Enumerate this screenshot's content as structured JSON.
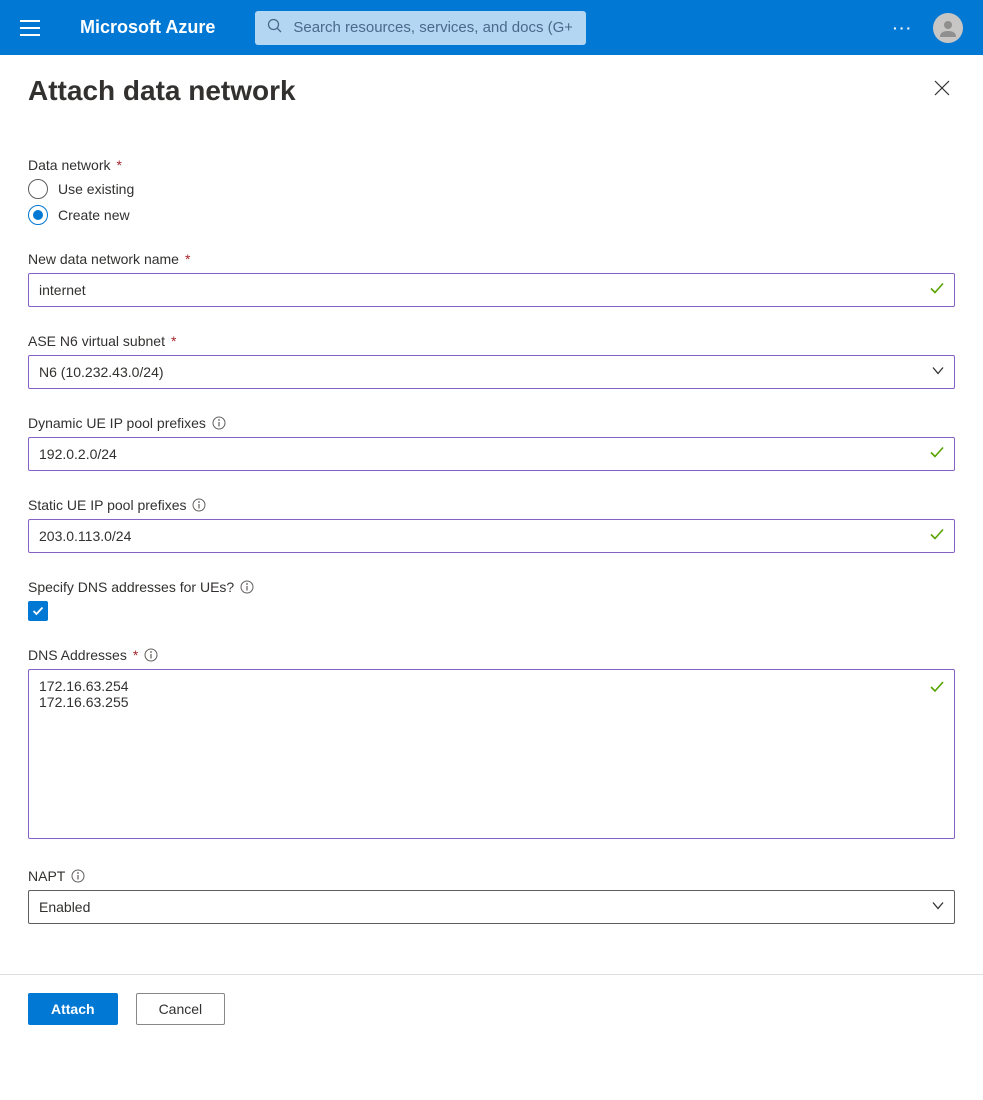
{
  "header": {
    "brand": "Microsoft Azure",
    "search_placeholder": "Search resources, services, and docs (G+/)"
  },
  "page": {
    "title": "Attach data network"
  },
  "form": {
    "data_network": {
      "label": "Data network",
      "option_existing": "Use existing",
      "option_new": "Create new",
      "selected": "Create new"
    },
    "new_name": {
      "label": "New data network name",
      "value": "internet"
    },
    "ase_n6": {
      "label": "ASE N6 virtual subnet",
      "value": "N6 (10.232.43.0/24)"
    },
    "dynamic_pool": {
      "label": "Dynamic UE IP pool prefixes",
      "value": "192.0.2.0/24"
    },
    "static_pool": {
      "label": "Static UE IP pool prefixes",
      "value": "203.0.113.0/24"
    },
    "specify_dns": {
      "label": "Specify DNS addresses for UEs?",
      "checked": true
    },
    "dns_addresses": {
      "label": "DNS Addresses",
      "value": "172.16.63.254\n172.16.63.255"
    },
    "napt": {
      "label": "NAPT",
      "value": "Enabled"
    }
  },
  "footer": {
    "attach": "Attach",
    "cancel": "Cancel"
  }
}
